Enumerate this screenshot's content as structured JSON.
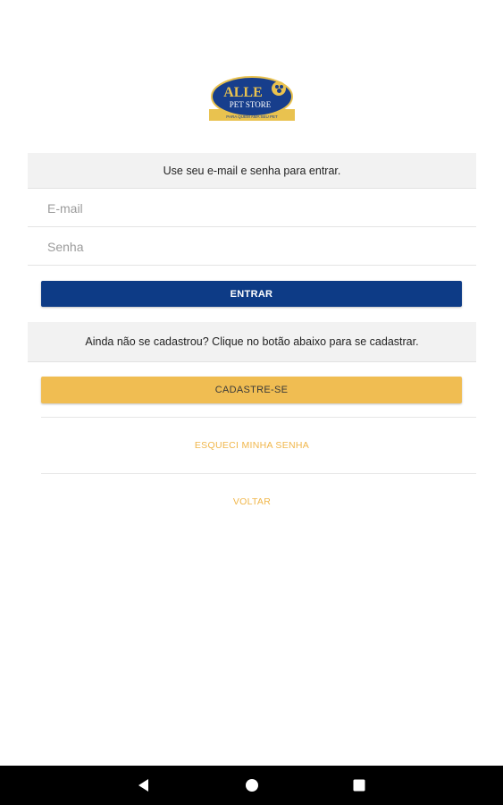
{
  "logo": {
    "name_top": "ALLE",
    "name_bottom": "PET STORE",
    "tagline": "PARA QUEM AMA SEU PET",
    "colors": {
      "navy": "#173e8c",
      "gold": "#e9c24f"
    }
  },
  "login": {
    "instruction": "Use seu e-mail e senha para entrar.",
    "email_placeholder": "E-mail",
    "password_placeholder": "Senha",
    "submit_label": "ENTRAR"
  },
  "register": {
    "prompt": "Ainda não se cadastrou? Clique no botão abaixo para se cadastrar.",
    "button_label": "CADASTRE-SE"
  },
  "links": {
    "forgot_password": "ESQUECI MINHA SENHA",
    "back": "VOLTAR"
  },
  "navbar": {
    "icons": [
      "back-triangle-icon",
      "home-circle-icon",
      "recents-square-icon"
    ]
  },
  "colors": {
    "primary": "#0d3b86",
    "accent": "#f0bd52",
    "link": "#f0b64a",
    "section_bg": "#f2f2f2"
  }
}
